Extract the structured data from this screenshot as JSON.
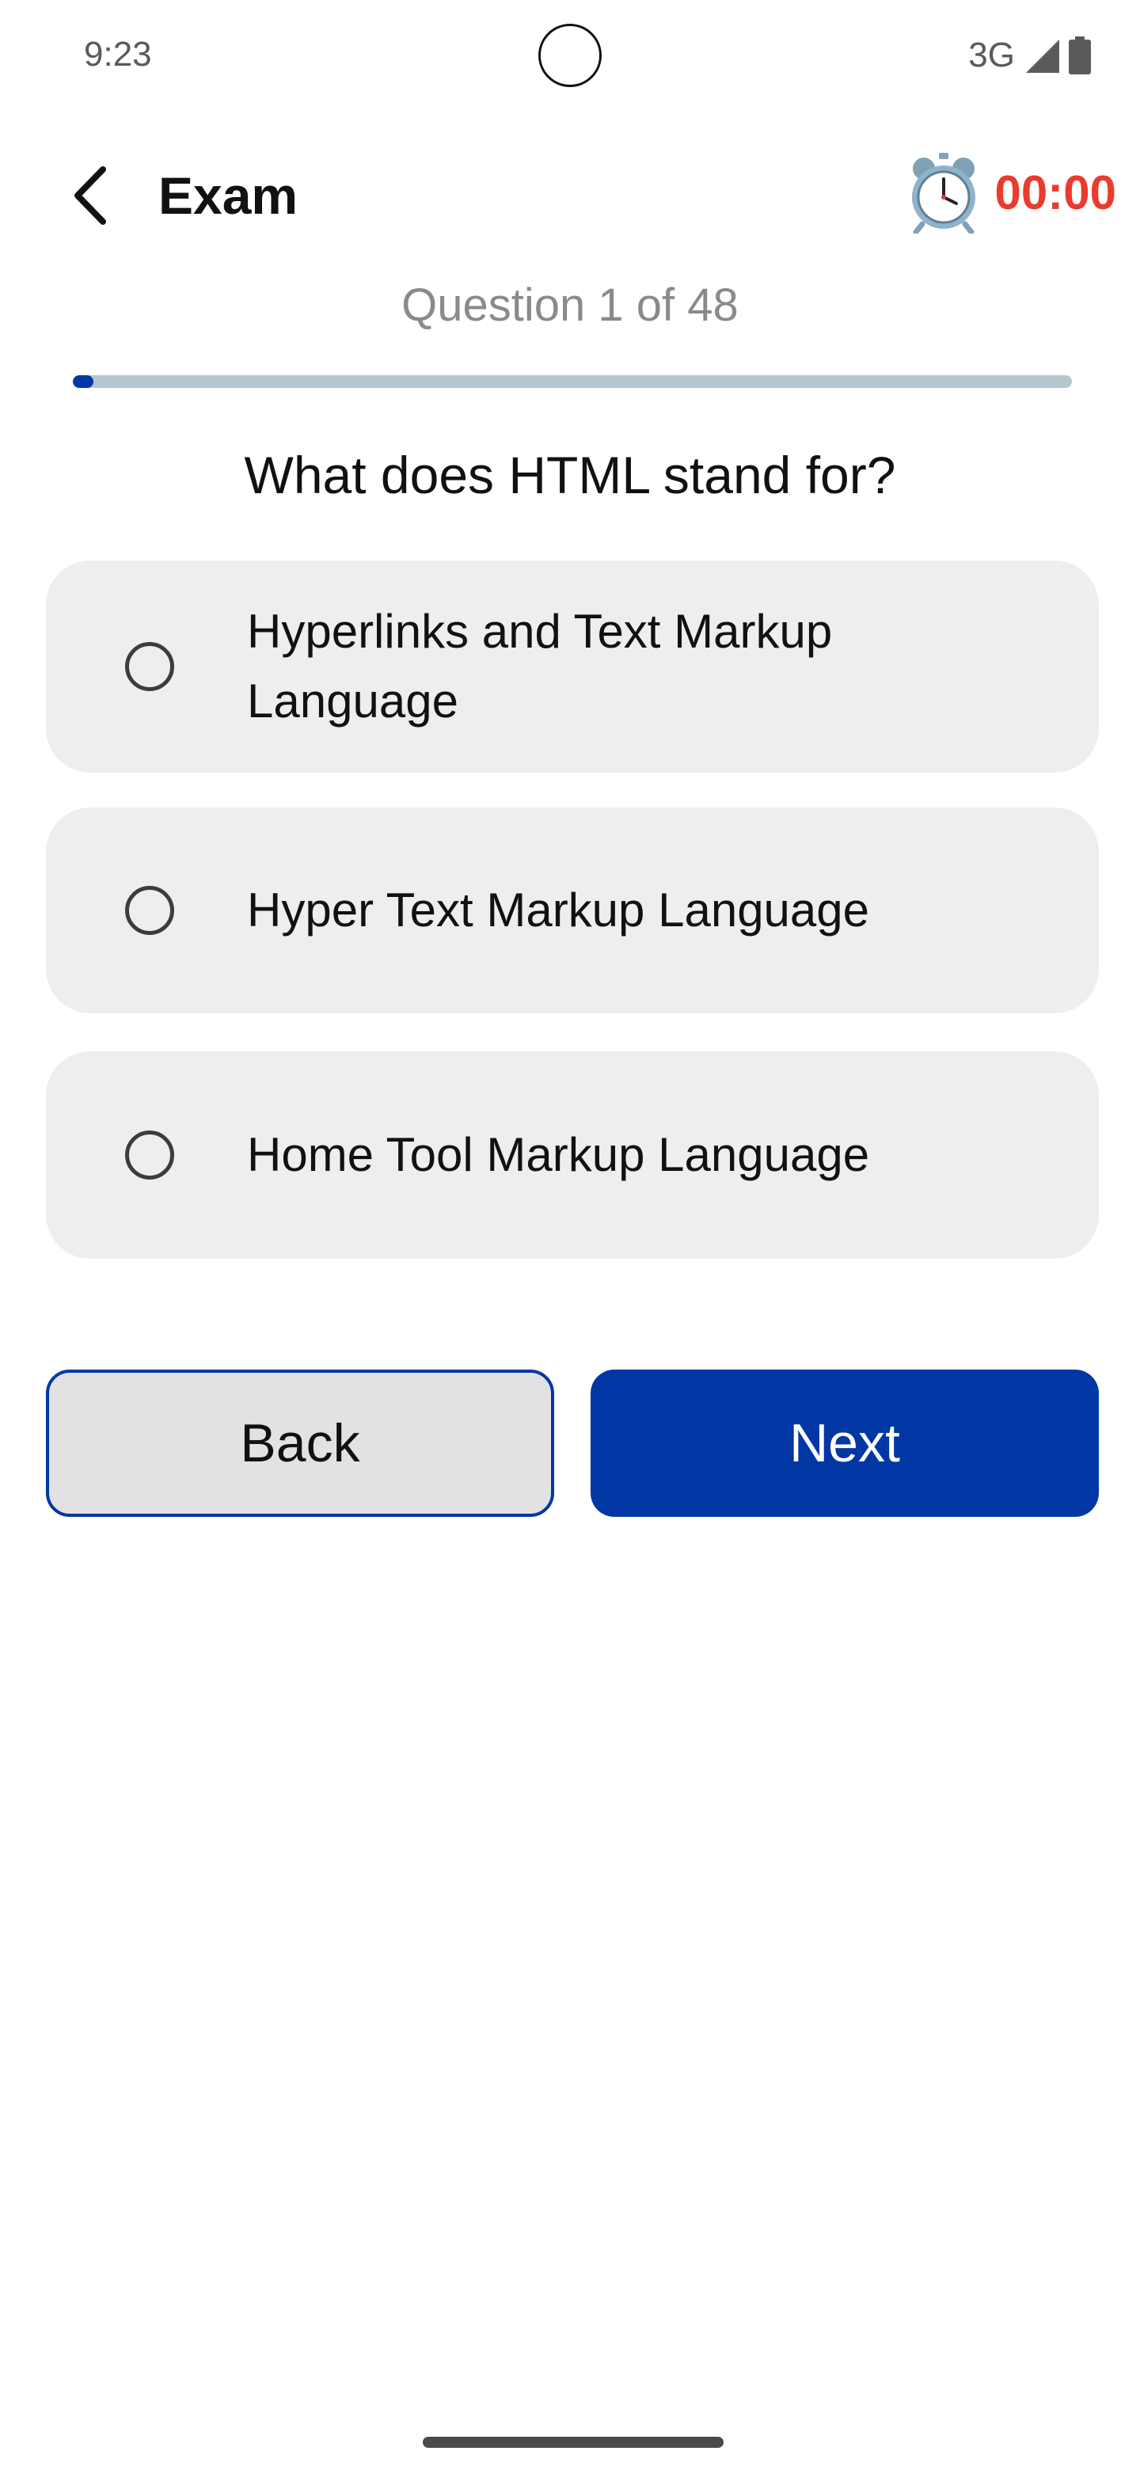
{
  "status_bar": {
    "time": "9:23",
    "network": "3G",
    "icons": [
      "signal-icon",
      "battery-icon"
    ]
  },
  "app_bar": {
    "back_icon": "back-arrow-icon",
    "title": "Exam",
    "timer_icon": "alarm-clock-icon",
    "timer": "00:00"
  },
  "progress": {
    "label": "Question 1 of 48",
    "current": 1,
    "total": 48,
    "fraction": 0.0208
  },
  "question": {
    "text": "What does HTML stand for?",
    "options": [
      {
        "label": "Hyperlinks and Text Markup Language",
        "selected": false
      },
      {
        "label": "Hyper Text Markup Language",
        "selected": false
      },
      {
        "label": "Home Tool Markup Language",
        "selected": false
      }
    ]
  },
  "buttons": {
    "back_label": "Back",
    "next_label": "Next"
  },
  "colors": {
    "accent": "#0037a4",
    "timer": "#ea3b2e",
    "option_bg": "#eeeeee",
    "progress_track": "#b7c6ce",
    "counter_text": "#8a8a8a"
  }
}
